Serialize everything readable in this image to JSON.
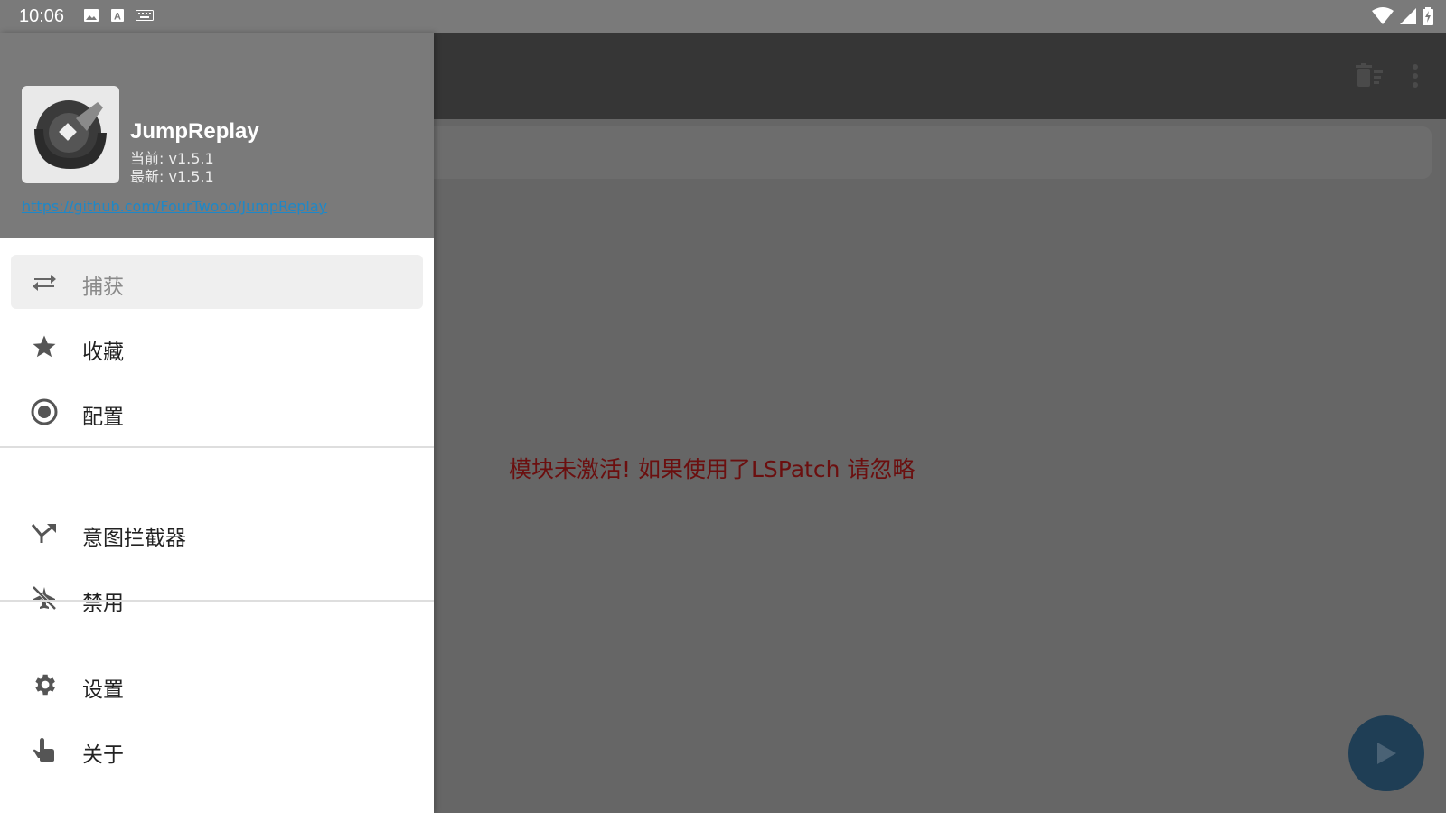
{
  "status_bar": {
    "time": "10:06",
    "left_icons": [
      "image-icon",
      "text-a-icon",
      "keyboard-icon"
    ],
    "right_icons": [
      "wifi-icon",
      "signal-icon",
      "battery-charging-icon"
    ]
  },
  "drawer": {
    "header": {
      "app_name": "JumpReplay",
      "current_version": "当前: v1.5.1",
      "latest_version": "最新: v1.5.1",
      "link": "https://github.com/FourTwooo/JumpReplay"
    },
    "groups": [
      {
        "items": [
          {
            "label": "捕获",
            "icon": "swap-arrows-icon",
            "active": true
          },
          {
            "label": "收藏",
            "icon": "star-icon",
            "active": false
          },
          {
            "label": "配置",
            "icon": "radio-target-icon",
            "active": false
          }
        ]
      },
      {
        "items": [
          {
            "label": "意图拦截器",
            "icon": "merge-arrow-icon",
            "active": false
          },
          {
            "label": "禁用",
            "icon": "disabled-airplane-icon",
            "active": false
          }
        ]
      },
      {
        "items": [
          {
            "label": "设置",
            "icon": "gear-icon",
            "active": false
          },
          {
            "label": "关于",
            "icon": "hand-pointer-icon",
            "active": false
          }
        ]
      }
    ]
  },
  "main": {
    "appbar_actions": [
      "clear-list-icon",
      "more-vert-icon"
    ],
    "message": "模块未激活! 如果使用了LSPatch 请忽略",
    "fab_icon": "play-icon"
  },
  "colors": {
    "drawer_header": "#7a7a7a",
    "scrim": "#666666",
    "appbar": "#363636",
    "message_text": "#6b0f0f",
    "link": "#1e88c8",
    "fab": "#1f3e55"
  }
}
